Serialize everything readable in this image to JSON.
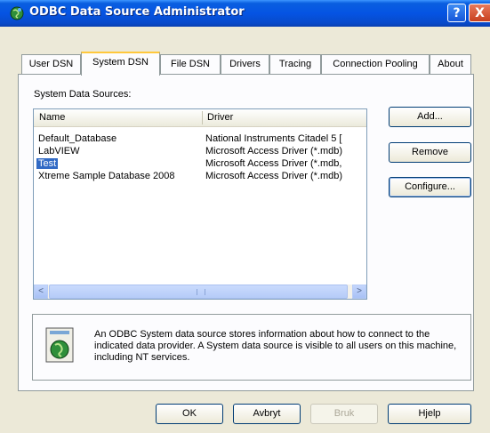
{
  "window": {
    "title": "ODBC Data Source Administrator",
    "help_label": "?",
    "close_label": "X"
  },
  "tabs": [
    {
      "label": "User DSN"
    },
    {
      "label": "System DSN"
    },
    {
      "label": "File DSN"
    },
    {
      "label": "Drivers"
    },
    {
      "label": "Tracing"
    },
    {
      "label": "Connection Pooling"
    },
    {
      "label": "About"
    }
  ],
  "active_tab": "System DSN",
  "panel": {
    "section_label": "System Data Sources:",
    "columns": [
      "Name",
      "Driver"
    ],
    "rows": [
      {
        "name": "Default_Database",
        "driver": "National Instruments Citadel 5 ["
      },
      {
        "name": "LabVIEW",
        "driver": "Microsoft Access Driver (*.mdb)"
      },
      {
        "name": "Test",
        "driver": "Microsoft Access Driver (*.mdb,"
      },
      {
        "name": "Xtreme Sample Database 2008",
        "driver": "Microsoft Access Driver (*.mdb)"
      }
    ],
    "selected_row": "Test",
    "scroll_left": "<",
    "scroll_right": ">",
    "add_label": "Add...",
    "remove_label": "Remove",
    "configure_label": "Configure...",
    "info_text": "An ODBC System data source stores information about how to connect to the indicated data provider.   A System data source is visible to all users on this machine, including NT services."
  },
  "footer": {
    "ok_label": "OK",
    "cancel_label": "Avbryt",
    "apply_label": "Bruk",
    "help_label": "Hjelp"
  },
  "colors": {
    "titlebar": "#0554e3",
    "selection": "#316ac5",
    "dialog_bg": "#ece9d8"
  }
}
